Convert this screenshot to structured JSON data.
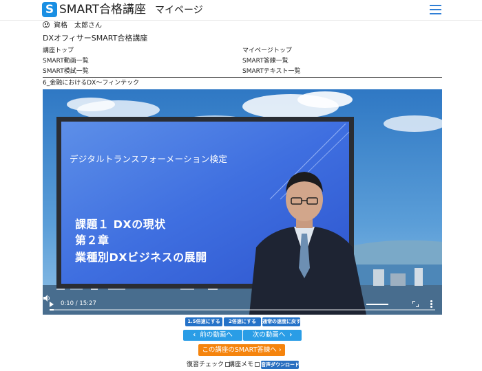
{
  "header": {
    "logo_letter": "S",
    "brand": "SMART合格講座",
    "mypage": "マイページ",
    "menu_icon": "hamburger-menu-icon",
    "accent": "#1a8fe3"
  },
  "user": {
    "icon": "smiley-icon",
    "name": "資格　太郎さん"
  },
  "course": {
    "title": "DXオフィサーSMART合格講座"
  },
  "nav": {
    "left": [
      "講座トップ",
      "SMART動画一覧",
      "SMART模試一覧"
    ],
    "right": [
      "マイページトップ",
      "SMART答練一覧",
      "SMARTテキスト一覧"
    ]
  },
  "lesson": {
    "title": "6_金融におけるDX〜フィンテック"
  },
  "video": {
    "slide_subtitle": "デジタルトランスフォーメーション検定",
    "slide_line1": "課題１ DXの現状",
    "slide_line2": "第２章",
    "slide_line3": "業種別DXビジネスの展開",
    "time": "0:10 / 15:27",
    "progress": 0.011,
    "volume": 1.0
  },
  "speed_buttons": [
    "1.5倍速にする",
    "2倍速にする",
    "通常の速度に戻す"
  ],
  "nav_buttons": {
    "prev": "前の動画へ",
    "next": "次の動画へ"
  },
  "answer_button": "この講座のSMART答練へ",
  "checks": {
    "review": "復習チェック",
    "memo": "講座メモ"
  },
  "audio_download": "音声ダウンロード",
  "colors": {
    "speed_button": "#2472c8",
    "nav_button": "#2a9de6",
    "answer_button": "#f5840d",
    "download_button": "#2a6fc0"
  }
}
